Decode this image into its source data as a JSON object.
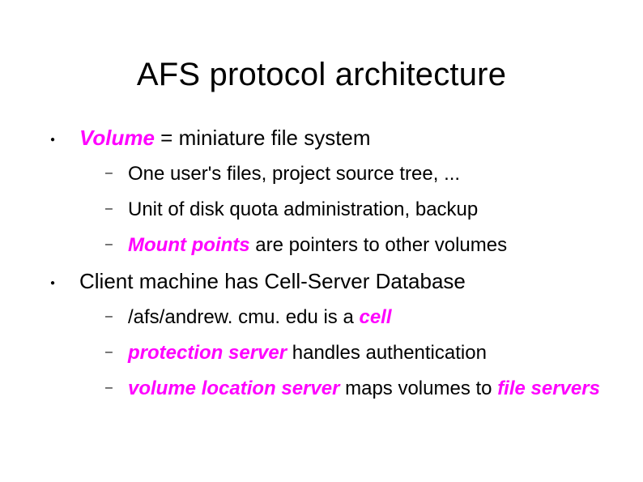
{
  "title": "AFS protocol architecture",
  "bullets": [
    {
      "term": "Volume",
      "after": " = miniature file system",
      "sub": [
        {
          "plain": "One user's files, project source tree, ..."
        },
        {
          "plain": "Unit of disk quota administration, backup"
        },
        {
          "emph": "Mount points",
          "rest": " are pointers to other volumes"
        }
      ]
    },
    {
      "plain": "Client machine has Cell-Server Database",
      "sub": [
        {
          "pre": "/afs/andrew. cmu. edu is a ",
          "emph2": "cell"
        },
        {
          "emph": "protection server",
          "rest": " handles authentication"
        },
        {
          "emph": "volume location server",
          "mid": " maps volumes to ",
          "emph2": "file servers"
        }
      ]
    }
  ]
}
